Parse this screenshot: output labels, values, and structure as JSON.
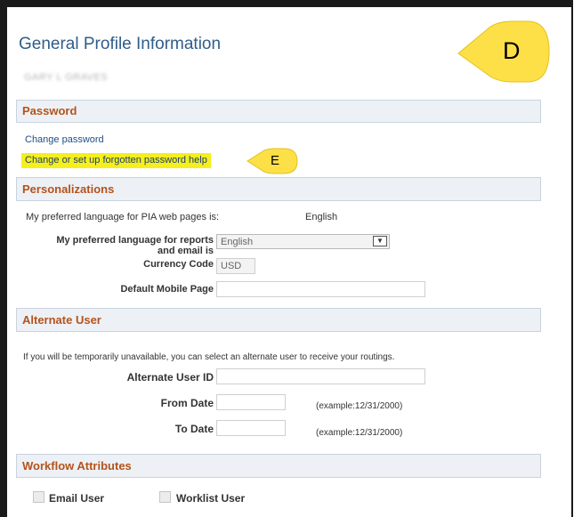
{
  "page": {
    "title": "General Profile Information",
    "user_name": "GARY L GRAVES"
  },
  "callouts": {
    "d": "D",
    "e": "E",
    "color": "#fde047"
  },
  "password": {
    "header": "Password",
    "change_password": "Change password",
    "forgotten_help": "Change or set up forgotten password help"
  },
  "personalizations": {
    "header": "Personalizations",
    "pia_language_label": "My preferred language for PIA web pages is:",
    "pia_language_value": "English",
    "report_language_label_1": "My preferred language for reports",
    "report_language_label_2": "and email is",
    "report_language_value": "English",
    "currency_label": "Currency Code",
    "currency_value": "USD",
    "mobile_page_label": "Default Mobile Page",
    "mobile_page_value": ""
  },
  "alternate_user": {
    "header": "Alternate User",
    "description": "If you will be temporarily unavailable, you can select an alternate user to receive your routings.",
    "user_id_label": "Alternate User ID",
    "user_id_value": "",
    "from_date_label": "From Date",
    "from_date_value": "",
    "from_date_hint": "(example:12/31/2000)",
    "to_date_label": "To Date",
    "to_date_value": "",
    "to_date_hint": "(example:12/31/2000)"
  },
  "workflow": {
    "header": "Workflow Attributes",
    "email_user_label": "Email User",
    "email_user_checked": false,
    "worklist_user_label": "Worklist User",
    "worklist_user_checked": false
  },
  "colors": {
    "title": "#2f5d8a",
    "section_header_text": "#b5521b",
    "section_header_bg": "#edf1f6",
    "link": "#1f4f86",
    "highlight": "#f4ef1d"
  }
}
